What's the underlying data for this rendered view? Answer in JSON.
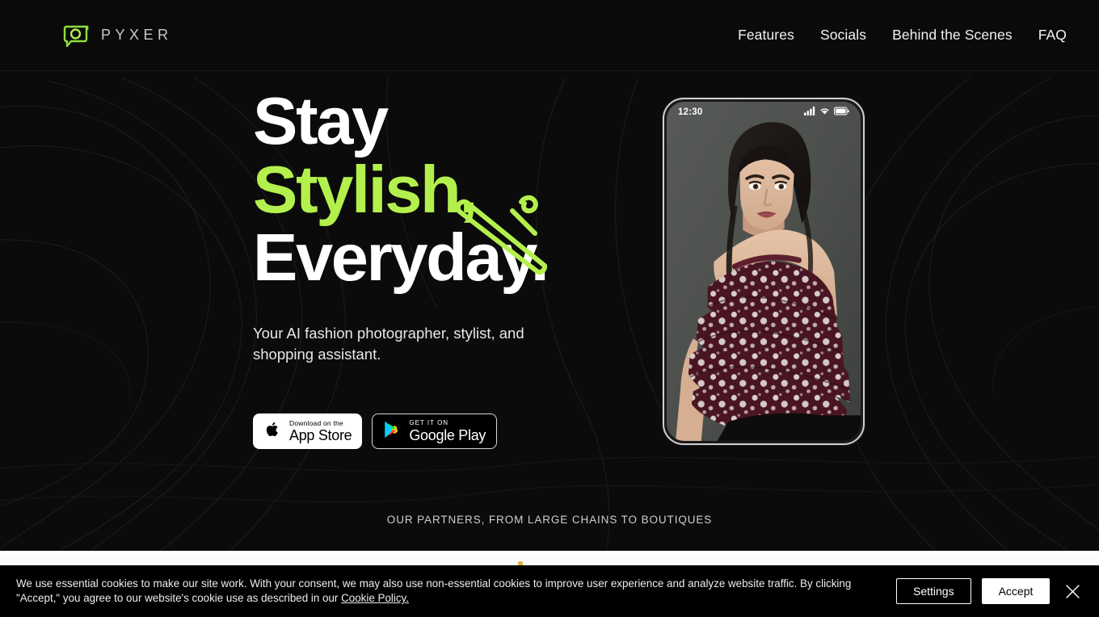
{
  "header": {
    "brand_name": "PYXER",
    "logo_icon": "camera-bubble-icon",
    "nav": [
      {
        "label": "Features"
      },
      {
        "label": "Socials"
      },
      {
        "label": "Behind the Scenes"
      },
      {
        "label": "FAQ"
      }
    ]
  },
  "hero": {
    "headline_line1": "Stay",
    "headline_line2": "Stylish,",
    "headline_line3": "Everyday.",
    "subheadline": "Your AI fashion photographer, stylist, and shopping assistant.",
    "accent_color": "#b4f04d",
    "decor_icon": "clothes-hanger-icon",
    "badges": [
      {
        "small": "Download on the",
        "large": "App Store",
        "icon": "apple-icon"
      },
      {
        "small": "GET IT ON",
        "large": "Google Play",
        "icon": "google-play-icon"
      }
    ],
    "phone": {
      "status_time": "12:30",
      "status_icons": [
        "cellular-signal-icon",
        "wifi-icon",
        "battery-icon"
      ],
      "screen_content": "fashion-model-photo"
    }
  },
  "partners": {
    "label": "OUR PARTNERS, FROM LARGE CHAINS TO BOUTIQUES"
  },
  "cookie_banner": {
    "text_before_link": "We use essential cookies to make our site work. With your consent, we may also use non-essential cookies to improve user experience and analyze website traffic. By clicking \"Accept,\" you agree to our website's cookie use as described in our ",
    "link_label": "Cookie Policy.",
    "settings_label": "Settings",
    "accept_label": "Accept",
    "close_icon": "close-icon"
  }
}
